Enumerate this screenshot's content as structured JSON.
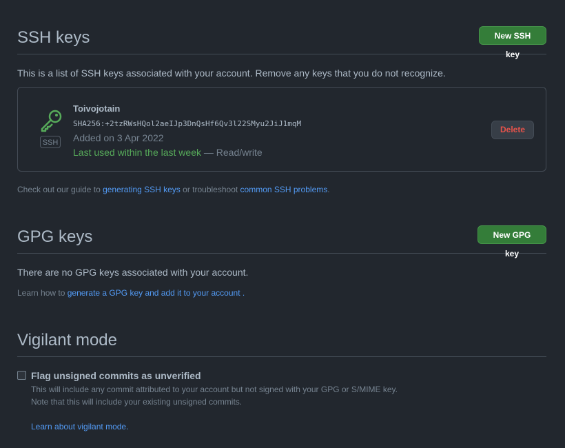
{
  "ssh": {
    "title": "SSH keys",
    "new_button": "New SSH key",
    "description": "This is a list of SSH keys associated with your account. Remove any keys that you do not recognize.",
    "key": {
      "badge": "SSH",
      "title": "Toivojotain",
      "fingerprint": "SHA256:+2tzRWsHQol2aeIJp3DnQsHf6Qv3l22SMyu2JiJ1mqM",
      "added": "Added on 3 Apr 2022",
      "last_used": "Last used within the last week",
      "access": " — Read/write",
      "delete_label": "Delete"
    },
    "guide_prefix": "Check out our guide to ",
    "guide_link1": "generating SSH keys",
    "guide_middle": " or troubleshoot ",
    "guide_link2": "common SSH problems",
    "guide_suffix": "."
  },
  "gpg": {
    "title": "GPG keys",
    "new_button": "New GPG key",
    "empty": "There are no GPG keys associated with your account.",
    "learn_prefix": "Learn how to ",
    "learn_link": "generate a GPG key and add it to your account",
    "learn_suffix": " ."
  },
  "vigilant": {
    "title": "Vigilant mode",
    "checkbox_label": "Flag unsigned commits as unverified",
    "checked": false,
    "desc1": "This will include any commit attributed to your account but not signed with your GPG or S/MIME key.",
    "desc2": "Note that this will include your existing unsigned commits.",
    "learn_link": "Learn about vigilant mode."
  },
  "colors": {
    "background": "#22272e",
    "green_button": "#347d39",
    "link": "#539bf5",
    "danger": "#e5534b",
    "success": "#57ab5a"
  }
}
